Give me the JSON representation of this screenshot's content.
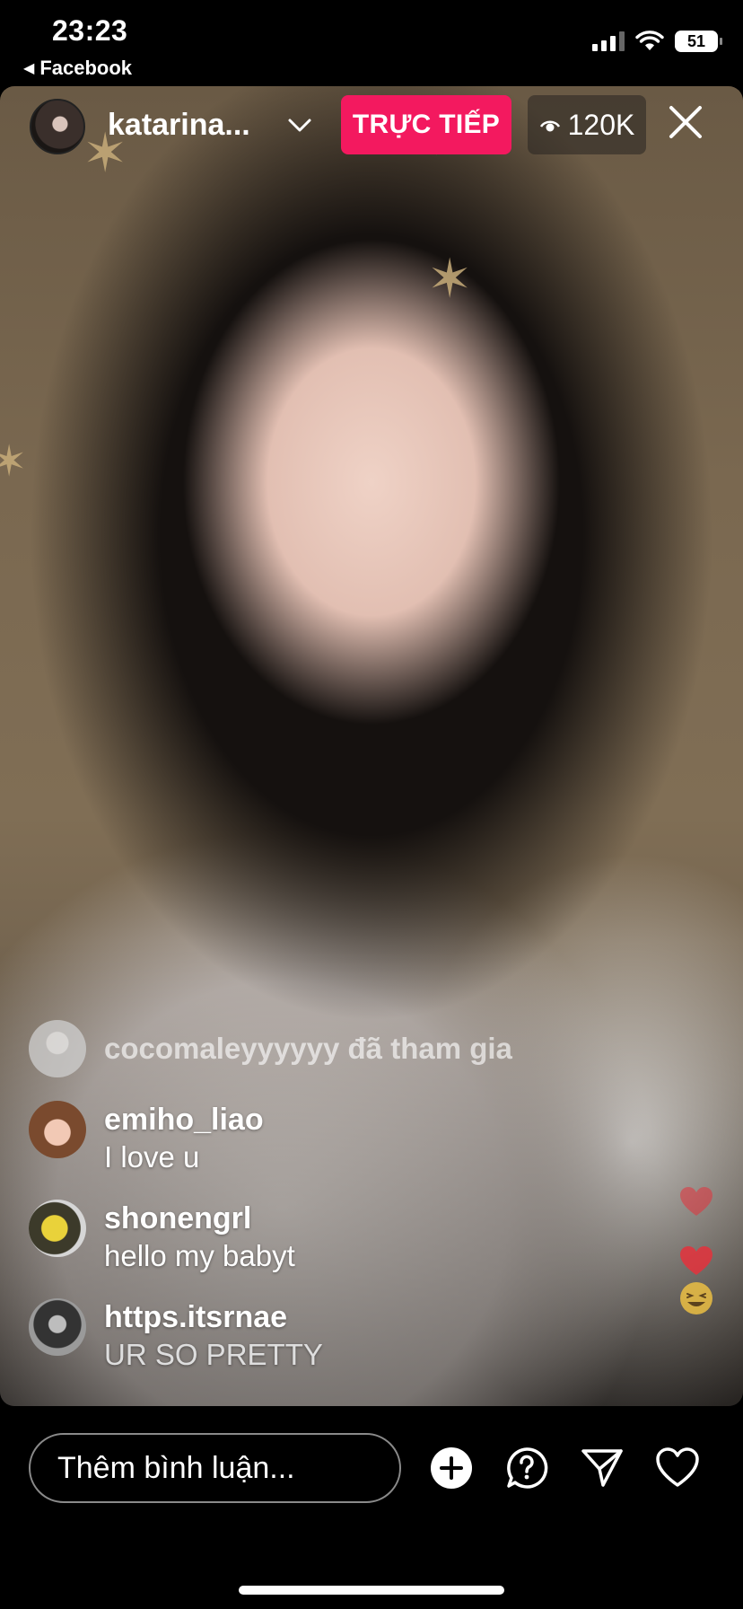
{
  "status_bar": {
    "time": "23:23",
    "back_app": "Facebook",
    "battery": "51"
  },
  "live": {
    "host_name": "katarina...",
    "live_label": "TRỰC TIẾP",
    "viewer_count": "120K",
    "badge_color": "#f3195f"
  },
  "comments": [
    {
      "type": "join",
      "user": "cocomaleyyyyyy",
      "message": "cocomaleyyyyyy đã tham gia"
    },
    {
      "type": "comment",
      "user": "emiho_liao",
      "message": "I love u"
    },
    {
      "type": "comment",
      "user": "shonengrl",
      "message": "hello my babyt"
    },
    {
      "type": "comment",
      "user": "https.itsrnae",
      "message": "UR SO PRETTY"
    }
  ],
  "reactions": [
    "heart-icon",
    "heart-icon",
    "laughing-emoji-icon"
  ],
  "bottom_bar": {
    "comment_placeholder": "Thêm bình luận...",
    "icons": [
      "plus-circle-icon",
      "question-bubble-icon",
      "send-icon",
      "heart-icon"
    ]
  }
}
